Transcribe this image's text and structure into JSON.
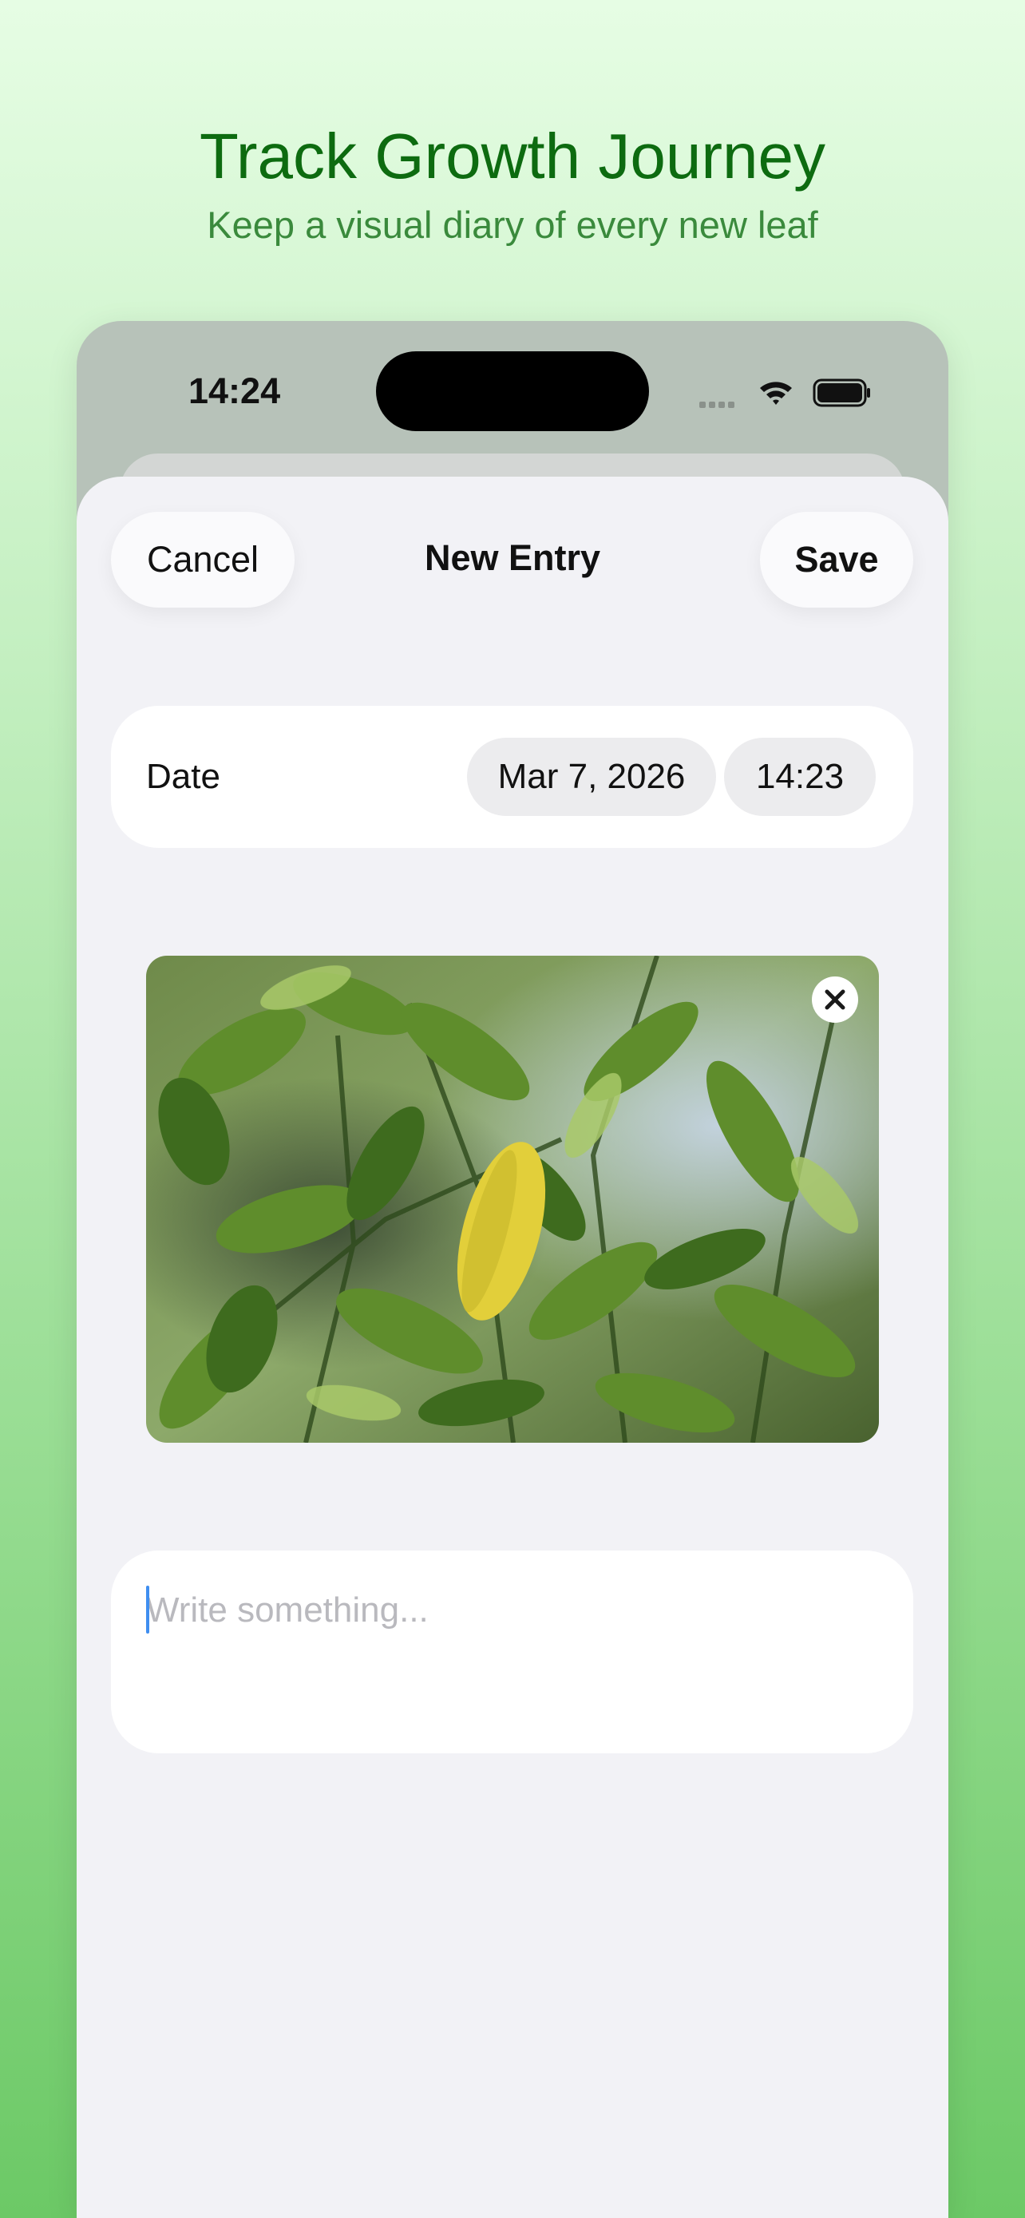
{
  "promo": {
    "title": "Track Growth Journey",
    "subtitle": "Keep a visual diary of every new leaf"
  },
  "status_bar": {
    "time": "14:24",
    "icons": [
      "cellular-icon",
      "wifi-icon",
      "battery-icon"
    ]
  },
  "sheet": {
    "title": "New Entry",
    "cancel_label": "Cancel",
    "save_label": "Save"
  },
  "date_row": {
    "label": "Date",
    "date_value": "Mar 7, 2026",
    "time_value": "14:23"
  },
  "photo": {
    "description_icon": "plant-photo",
    "remove_icon": "close-icon"
  },
  "notes": {
    "placeholder": "Write something...",
    "value": ""
  },
  "colors": {
    "title_green": "#0d6b10",
    "subtitle_green": "#3a8a3c",
    "sheet_background": "#f2f2f6",
    "caret_blue": "#3f8ef0"
  }
}
